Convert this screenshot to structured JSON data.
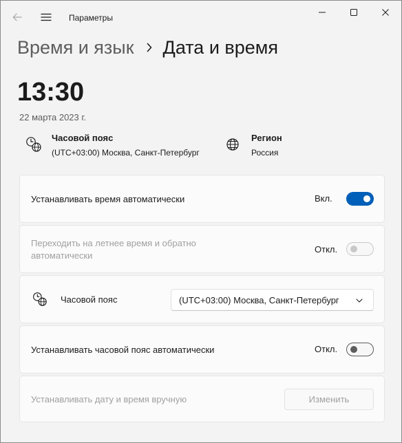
{
  "window": {
    "title": "Параметры"
  },
  "breadcrumb": {
    "parent": "Время и язык",
    "current": "Дата и время"
  },
  "clock": {
    "time": "13:30",
    "date": "22 марта 2023 г."
  },
  "info": {
    "timezone_label": "Часовой пояс",
    "timezone_value": "(UTC+03:00) Москва, Санкт-Петербург",
    "region_label": "Регион",
    "region_value": "Россия"
  },
  "settings": {
    "auto_time": {
      "label": "Устанавливать время автоматически",
      "state": "Вкл."
    },
    "dst": {
      "label_line1": "Переходить на летнее время и обратно",
      "label_line2": "автоматически",
      "state": "Откл."
    },
    "timezone": {
      "label": "Часовой пояс",
      "selected": "(UTC+03:00) Москва, Санкт-Петербург"
    },
    "auto_timezone": {
      "label": "Устанавливать часовой пояс автоматически",
      "state": "Откл."
    },
    "manual": {
      "label": "Устанавливать дату и время вручную",
      "button": "Изменить"
    }
  },
  "colors": {
    "accent": "#005fb8",
    "background": "#f3f3f3",
    "card": "#fbfbfb",
    "disabled_text": "#a0a0a0"
  },
  "icons": [
    "back-arrow-icon",
    "hamburger-menu-icon",
    "minimize-icon",
    "maximize-icon",
    "close-icon",
    "chevron-right-icon",
    "clock-globe-icon",
    "globe-icon",
    "chevron-down-icon"
  ]
}
